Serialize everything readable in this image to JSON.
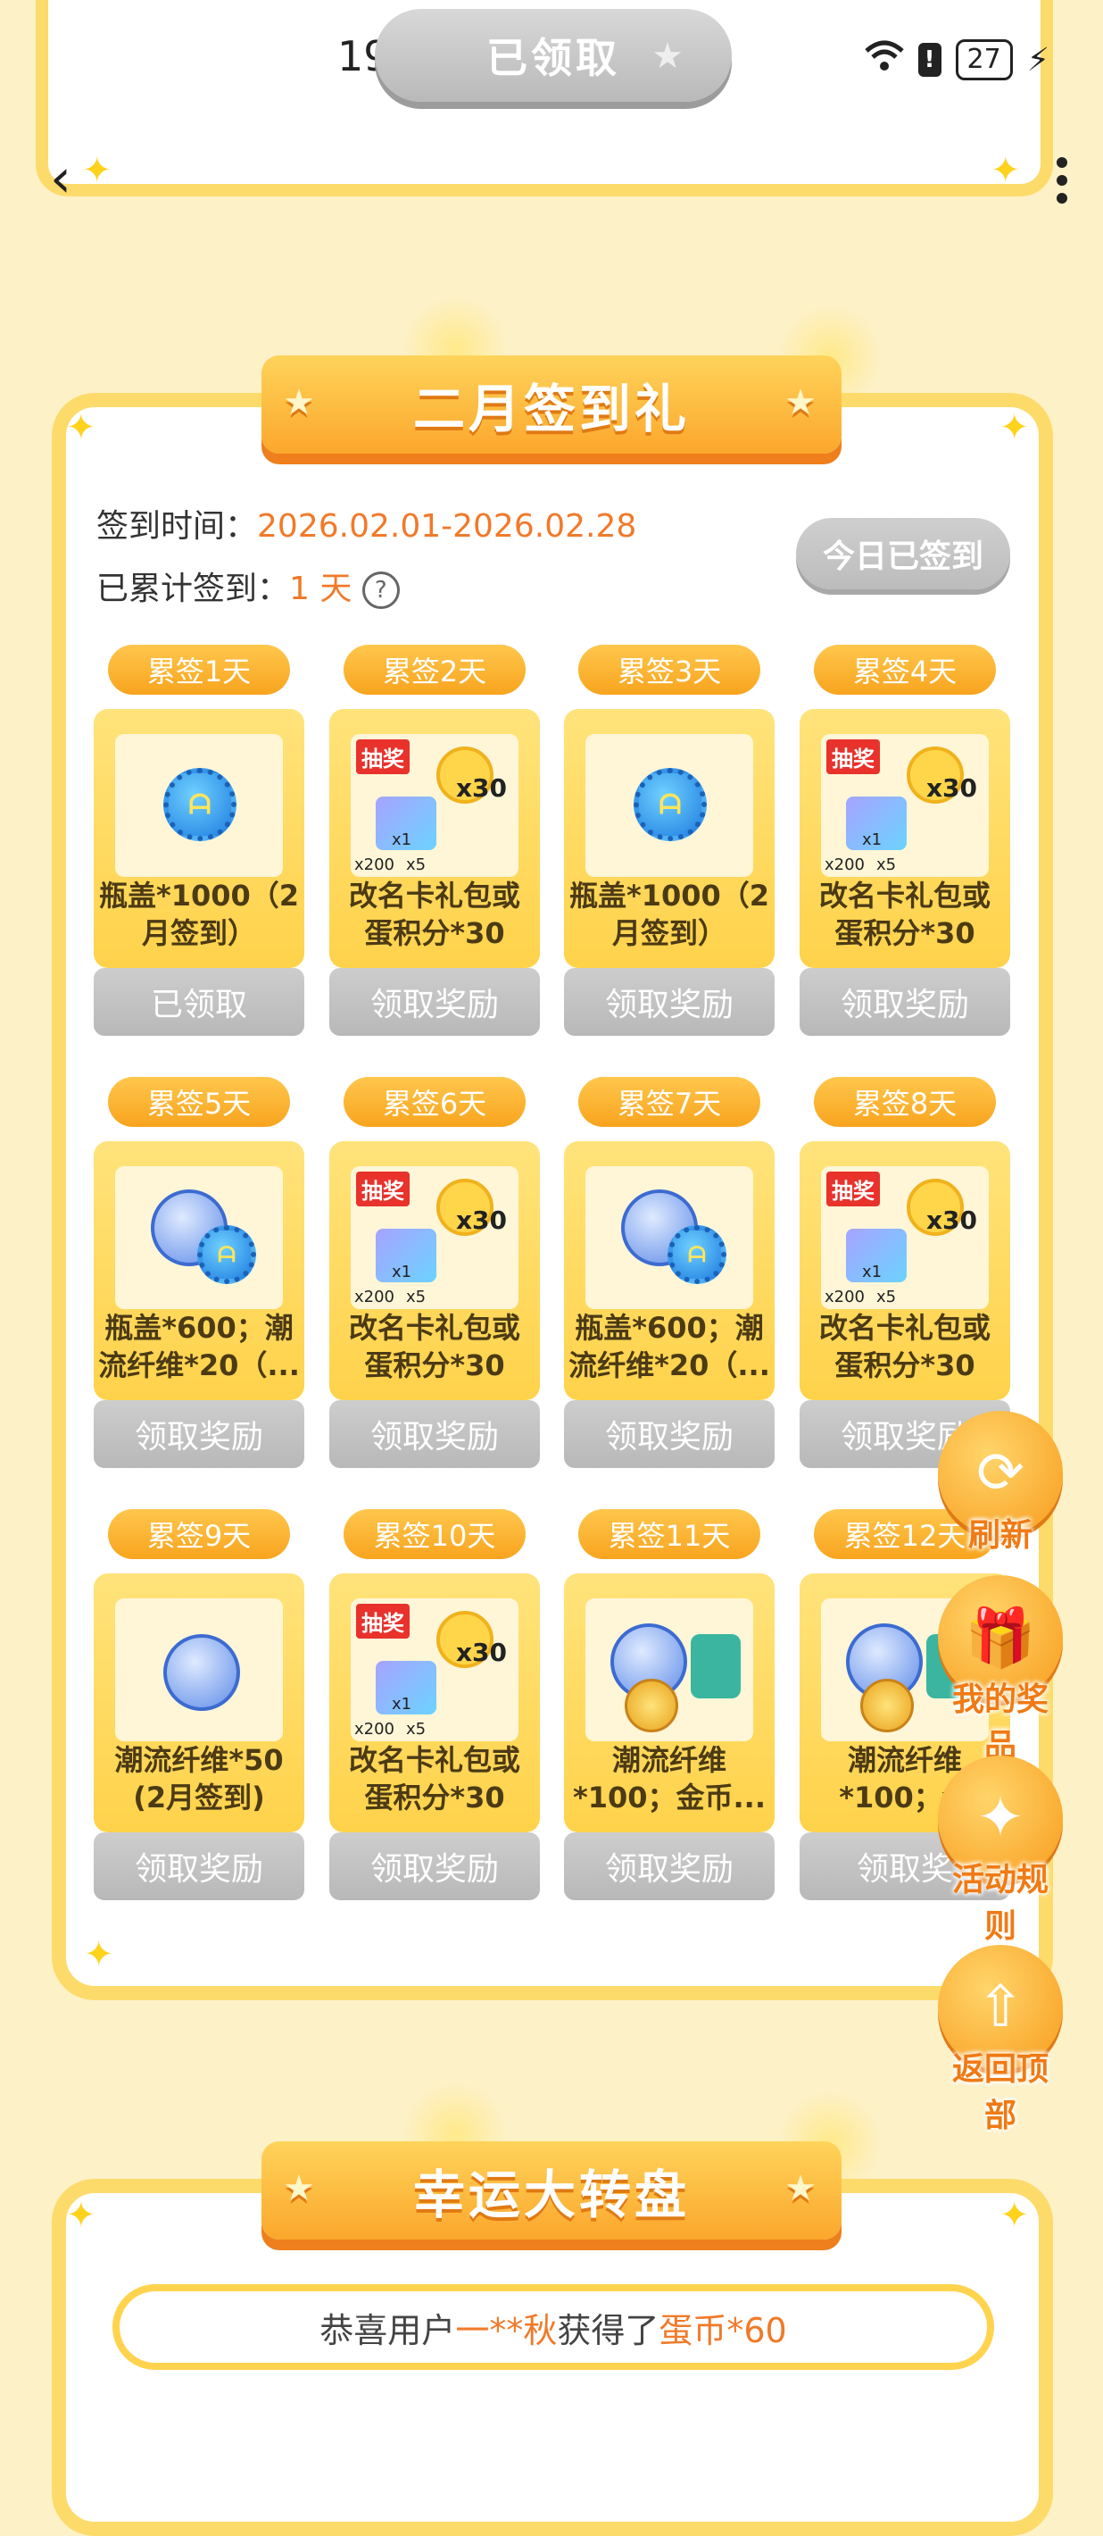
{
  "status_bar": {
    "time": "19:39",
    "battery": "27"
  },
  "top": {
    "claimed_label": "已领取"
  },
  "signin": {
    "title": "二月签到礼",
    "time_label": "签到时间：",
    "time_value": "2026.02.01-2026.02.28",
    "count_label": "已累计签到：",
    "count_value": "1 天",
    "info_glyph": "?",
    "today_button": "今日已签到",
    "rows": [
      [
        {
          "day": "累签1天",
          "name": "瓶盖*1000（2\n月签到）",
          "icon": "bottle-cap-icon",
          "button": "已领取"
        },
        {
          "day": "累签2天",
          "name": "改名卡礼包或\n蛋积分*30",
          "icon": "lottery-gift-icon",
          "button": "领取奖励"
        },
        {
          "day": "累签3天",
          "name": "瓶盖*1000（2\n月签到）",
          "icon": "bottle-cap-icon",
          "button": "领取奖励"
        },
        {
          "day": "累签4天",
          "name": "改名卡礼包或\n蛋积分*30",
          "icon": "lottery-gift-icon",
          "button": "领取奖励"
        }
      ],
      [
        {
          "day": "累签5天",
          "name": "瓶盖*600；潮\n流纤维*20（...",
          "icon": "cap-yarn-icon",
          "button": "领取奖励"
        },
        {
          "day": "累签6天",
          "name": "改名卡礼包或\n蛋积分*30",
          "icon": "lottery-gift-icon",
          "button": "领取奖励"
        },
        {
          "day": "累签7天",
          "name": "瓶盖*600；潮\n流纤维*20（...",
          "icon": "cap-yarn-icon",
          "button": "领取奖励"
        },
        {
          "day": "累签8天",
          "name": "改名卡礼包或\n蛋积分*30",
          "icon": "lottery-gift-icon",
          "button": "领取奖励"
        }
      ],
      [
        {
          "day": "累签9天",
          "name": "潮流纤维*50\n(2月签到)",
          "icon": "yarn-icon",
          "button": "领取奖励"
        },
        {
          "day": "累签10天",
          "name": "改名卡礼包或\n蛋积分*30",
          "icon": "lottery-gift-icon",
          "button": "领取奖励"
        },
        {
          "day": "累签11天",
          "name": "潮流纤维\n*100；金币...",
          "icon": "yarn-coin-card-icon",
          "button": "领取奖励"
        },
        {
          "day": "累签12天",
          "name": "潮流纤维\n*100；金",
          "icon": "yarn-coin-card-icon",
          "button": "领取奖"
        }
      ]
    ],
    "lottery_tag": "抽奖",
    "lottery_mult": "x30",
    "lottery_small": [
      "x1",
      "x200",
      "x5"
    ]
  },
  "fabs": [
    {
      "label": "刷新",
      "icon": "refresh-icon",
      "glyph": "⟳"
    },
    {
      "label": "我的奖品",
      "icon": "gift-icon",
      "glyph": "🎁"
    },
    {
      "label": "活动规则",
      "icon": "rules-icon",
      "glyph": "✦"
    },
    {
      "label": "返回顶部",
      "icon": "back-to-top-icon",
      "glyph": "⇧"
    }
  ],
  "wheel": {
    "title": "幸运大转盘",
    "ticker_prefix": "恭喜用户",
    "ticker_user": "一**秋",
    "ticker_mid": "获得了",
    "ticker_prize": "蛋币*60"
  }
}
